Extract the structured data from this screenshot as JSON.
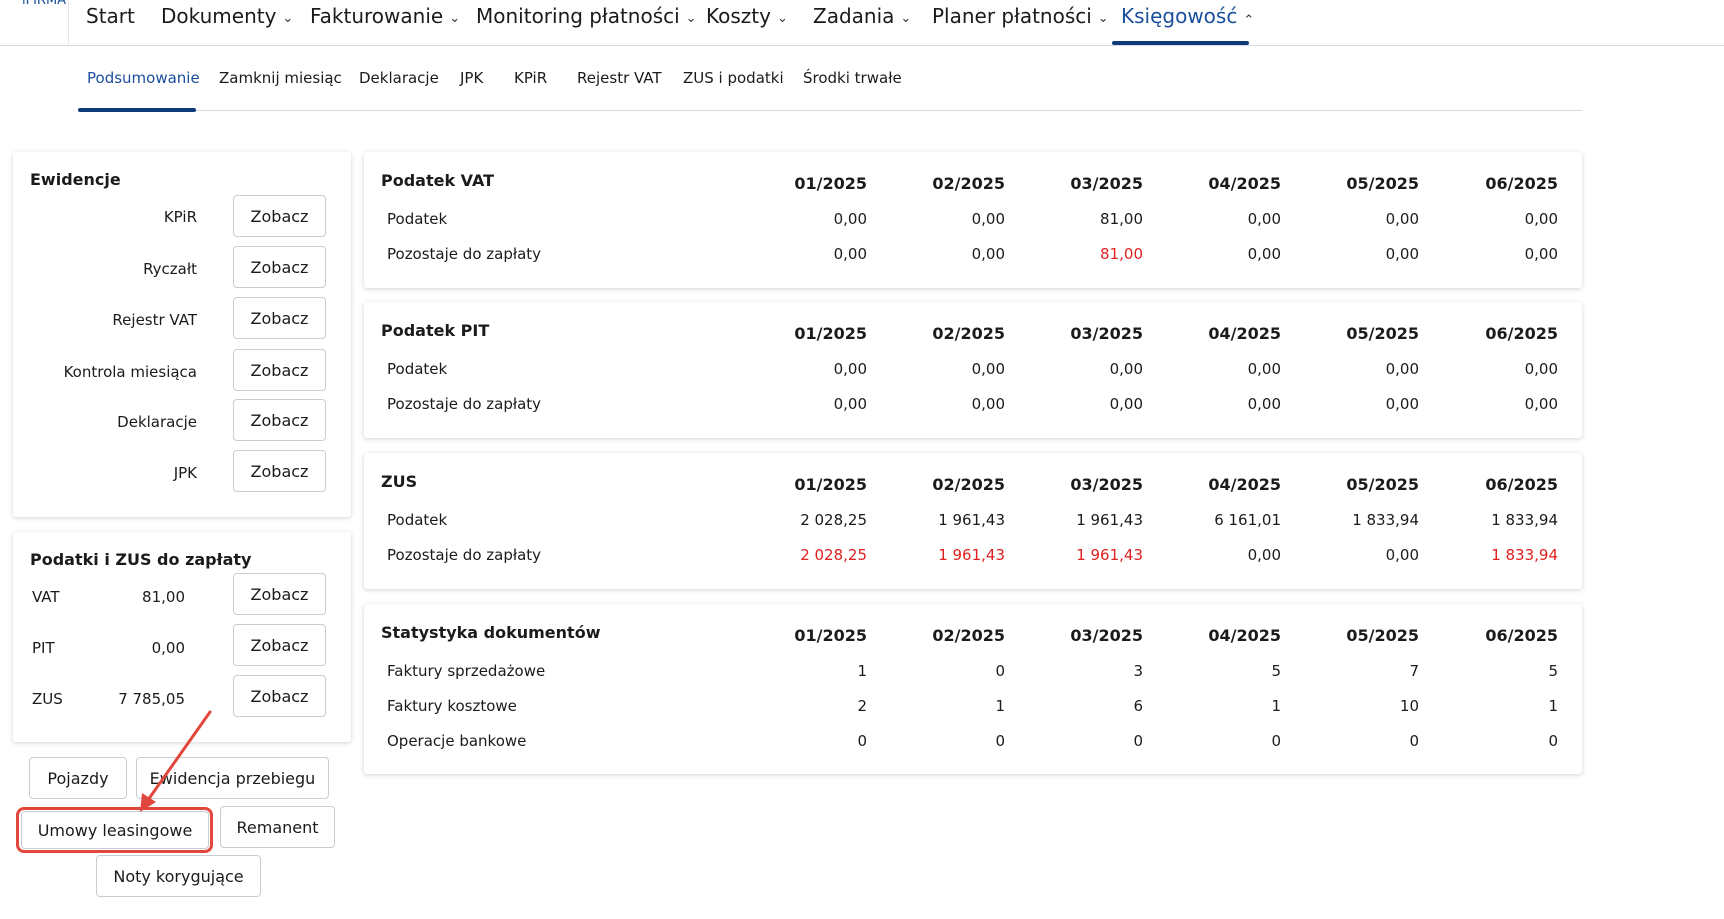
{
  "topnav": {
    "logo_fragment": "iFIRMA",
    "items": [
      {
        "label": "Start",
        "chevron": false,
        "active": false
      },
      {
        "label": "Dokumenty",
        "chevron": true,
        "active": false
      },
      {
        "label": "Fakturowanie",
        "chevron": true,
        "active": false
      },
      {
        "label": "Monitoring płatności",
        "chevron": true,
        "active": false
      },
      {
        "label": "Koszty",
        "chevron": true,
        "active": false
      },
      {
        "label": "Zadania",
        "chevron": true,
        "active": false
      },
      {
        "label": "Planer płatności",
        "chevron": true,
        "active": false
      },
      {
        "label": "Księgowość",
        "chevron": true,
        "active": true
      }
    ],
    "chevron_down": "⌄",
    "chevron_up": "⌃"
  },
  "subnav": {
    "items": [
      {
        "label": "Podsumowanie",
        "active": true
      },
      {
        "label": "Zamknij miesiąc",
        "active": false
      },
      {
        "label": "Deklaracje",
        "active": false
      },
      {
        "label": "JPK",
        "active": false
      },
      {
        "label": "KPiR",
        "active": false
      },
      {
        "label": "Rejestr VAT",
        "active": false
      },
      {
        "label": "ZUS i podatki",
        "active": false
      },
      {
        "label": "Środki trwałe",
        "active": false
      }
    ]
  },
  "ewidencje": {
    "title": "Ewidencje",
    "rows": [
      {
        "label": "KPiR",
        "button": "Zobacz"
      },
      {
        "label": "Ryczałt",
        "button": "Zobacz"
      },
      {
        "label": "Rejestr VAT",
        "button": "Zobacz"
      },
      {
        "label": "Kontrola miesiąca",
        "button": "Zobacz"
      },
      {
        "label": "Deklaracje",
        "button": "Zobacz"
      },
      {
        "label": "JPK",
        "button": "Zobacz"
      }
    ]
  },
  "podatki": {
    "title": "Podatki i ZUS do zapłaty",
    "rows": [
      {
        "label": "VAT",
        "value": "81,00",
        "button": "Zobacz"
      },
      {
        "label": "PIT",
        "value": "0,00",
        "button": "Zobacz"
      },
      {
        "label": "ZUS",
        "value": "7 785,05",
        "button": "Zobacz"
      }
    ]
  },
  "extra_buttons": {
    "pojazdy": "Pojazdy",
    "ewidencja_przebiegu": "Ewidencja przebiegu",
    "umowy_leasingowe": "Umowy leasingowe",
    "remanent": "Remanent",
    "noty_korygujace": "Noty korygujące"
  },
  "tables": [
    {
      "title": "Podatek VAT",
      "months": [
        "01/2025",
        "02/2025",
        "03/2025",
        "04/2025",
        "05/2025",
        "06/2025"
      ],
      "rows": [
        {
          "label": "Podatek",
          "values": [
            "0,00",
            "0,00",
            "81,00",
            "0,00",
            "0,00",
            "0,00"
          ],
          "red": [
            false,
            false,
            false,
            false,
            false,
            false
          ]
        },
        {
          "label": "Pozostaje do zapłaty",
          "values": [
            "0,00",
            "0,00",
            "81,00",
            "0,00",
            "0,00",
            "0,00"
          ],
          "red": [
            false,
            false,
            true,
            false,
            false,
            false
          ]
        }
      ]
    },
    {
      "title": "Podatek PIT",
      "months": [
        "01/2025",
        "02/2025",
        "03/2025",
        "04/2025",
        "05/2025",
        "06/2025"
      ],
      "rows": [
        {
          "label": "Podatek",
          "values": [
            "0,00",
            "0,00",
            "0,00",
            "0,00",
            "0,00",
            "0,00"
          ],
          "red": [
            false,
            false,
            false,
            false,
            false,
            false
          ]
        },
        {
          "label": "Pozostaje do zapłaty",
          "values": [
            "0,00",
            "0,00",
            "0,00",
            "0,00",
            "0,00",
            "0,00"
          ],
          "red": [
            false,
            false,
            false,
            false,
            false,
            false
          ]
        }
      ]
    },
    {
      "title": "ZUS",
      "months": [
        "01/2025",
        "02/2025",
        "03/2025",
        "04/2025",
        "05/2025",
        "06/2025"
      ],
      "rows": [
        {
          "label": "Podatek",
          "values": [
            "2 028,25",
            "1 961,43",
            "1 961,43",
            "6 161,01",
            "1 833,94",
            "1 833,94"
          ],
          "red": [
            false,
            false,
            false,
            false,
            false,
            false
          ]
        },
        {
          "label": "Pozostaje do zapłaty",
          "values": [
            "2 028,25",
            "1 961,43",
            "1 961,43",
            "0,00",
            "0,00",
            "1 833,94"
          ],
          "red": [
            true,
            true,
            true,
            false,
            false,
            true
          ]
        }
      ]
    },
    {
      "title": "Statystyka dokumentów",
      "months": [
        "01/2025",
        "02/2025",
        "03/2025",
        "04/2025",
        "05/2025",
        "06/2025"
      ],
      "rows": [
        {
          "label": "Faktury sprzedażowe",
          "values": [
            "1",
            "0",
            "3",
            "5",
            "7",
            "5"
          ],
          "red": [
            false,
            false,
            false,
            false,
            false,
            false
          ]
        },
        {
          "label": "Faktury kosztowe",
          "values": [
            "2",
            "1",
            "6",
            "1",
            "10",
            "1"
          ],
          "red": [
            false,
            false,
            false,
            false,
            false,
            false
          ]
        },
        {
          "label": "Operacje bankowe",
          "values": [
            "0",
            "0",
            "0",
            "0",
            "0",
            "0"
          ],
          "red": [
            false,
            false,
            false,
            false,
            false,
            false
          ]
        }
      ]
    }
  ],
  "colors": {
    "accent": "#1a4f9c",
    "underline": "#0f3a7a",
    "negative": "#e02020",
    "annotation": "#e2473d"
  }
}
